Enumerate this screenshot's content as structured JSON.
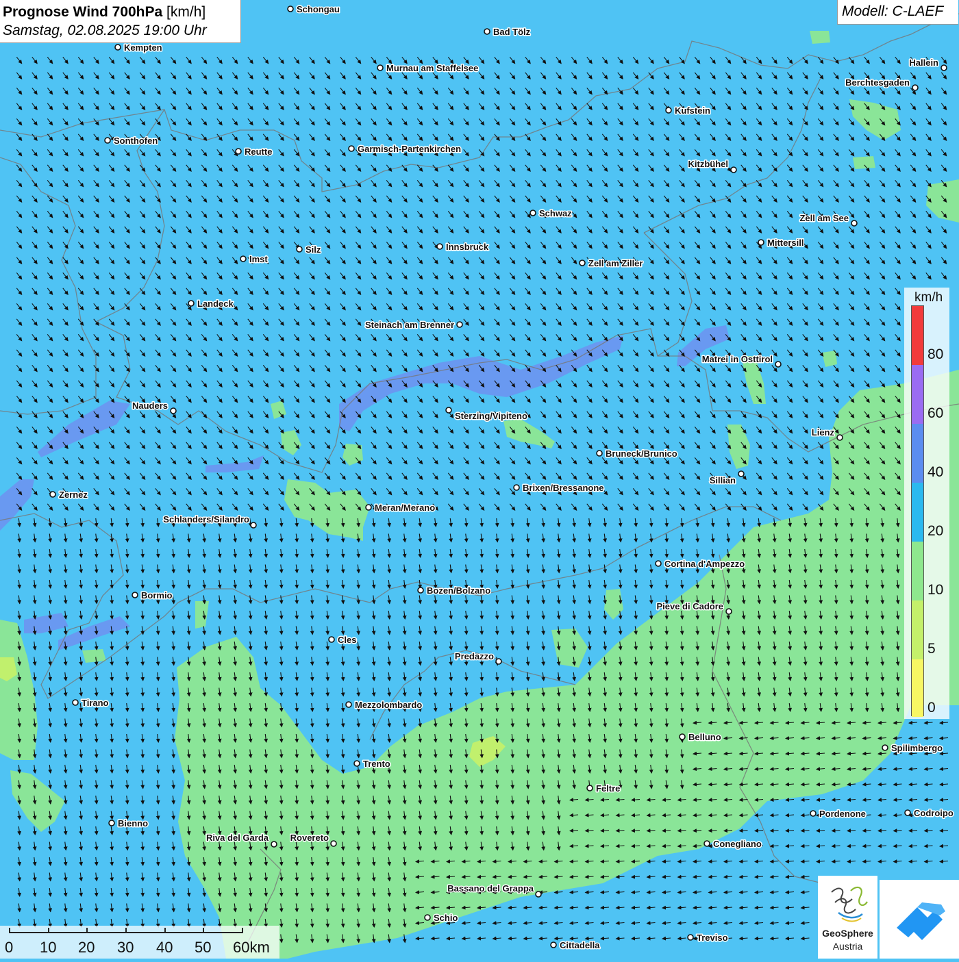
{
  "title": {
    "main_bold": "Prognose Wind 700hPa",
    "main_unit": "[km/h]",
    "datetime": "Samstag, 02.08.2025 19:00 Uhr"
  },
  "model": "Modell: C-LAEF",
  "legend": {
    "unit": "km/h",
    "ticks": [
      "80",
      "60",
      "40",
      "20",
      "10",
      "5",
      "0"
    ],
    "bins": [
      {
        "from": 0,
        "to": 5,
        "color": "#f7f763"
      },
      {
        "from": 5,
        "to": 10,
        "color": "#c4f06a"
      },
      {
        "from": 10,
        "to": 20,
        "color": "#8ee88e"
      },
      {
        "from": 20,
        "to": 40,
        "color": "#2bb9ef"
      },
      {
        "from": 40,
        "to": 60,
        "color": "#5b8df0"
      },
      {
        "from": 60,
        "to": 80,
        "color": "#9a6cf2"
      },
      {
        "from": 80,
        "to": 100,
        "color": "#f23b3b"
      }
    ]
  },
  "scale": {
    "labels": [
      "0",
      "10",
      "20",
      "30",
      "40",
      "50",
      "60km"
    ]
  },
  "logo": {
    "line1": "GeoSphere",
    "line2": "Austria"
  },
  "wind": {
    "prevailing_direction": "northwest",
    "south_direction": "west"
  },
  "cities": [
    {
      "name": "Schongau"
    },
    {
      "name": "Bad Tölz"
    },
    {
      "name": "Kempten"
    },
    {
      "name": "Murnau am Staffelsee"
    },
    {
      "name": "Hallein"
    },
    {
      "name": "Berchtesgaden"
    },
    {
      "name": "Kufstein"
    },
    {
      "name": "Sonthofen"
    },
    {
      "name": "Reutte"
    },
    {
      "name": "Garmisch-Partenkirchen"
    },
    {
      "name": "Kitzbühel"
    },
    {
      "name": "Schwaz"
    },
    {
      "name": "Zell am See"
    },
    {
      "name": "Mittersill"
    },
    {
      "name": "Innsbruck"
    },
    {
      "name": "Silz"
    },
    {
      "name": "Imst"
    },
    {
      "name": "Zell am Ziller"
    },
    {
      "name": "Landeck"
    },
    {
      "name": "Steinach am Brenner"
    },
    {
      "name": "Matrei in Osttirol"
    },
    {
      "name": "Nauders"
    },
    {
      "name": "Sterzing/Vipiteno"
    },
    {
      "name": "Lienz"
    },
    {
      "name": "Bruneck/Brunico"
    },
    {
      "name": "Sillian"
    },
    {
      "name": "Zernez"
    },
    {
      "name": "Brixen/Bressanone"
    },
    {
      "name": "Meran/Merano"
    },
    {
      "name": "Schlanders/Silandro"
    },
    {
      "name": "Cortina d'Ampezzo"
    },
    {
      "name": "Bozen/Bolzano"
    },
    {
      "name": "Bormio"
    },
    {
      "name": "Pieve di Cadore"
    },
    {
      "name": "Cles"
    },
    {
      "name": "Predazzo"
    },
    {
      "name": "Tirano"
    },
    {
      "name": "Mezzolombardo"
    },
    {
      "name": "Belluno"
    },
    {
      "name": "Spilimbergo"
    },
    {
      "name": "Trento"
    },
    {
      "name": "Feltre"
    },
    {
      "name": "Pordenone"
    },
    {
      "name": "Codroipo"
    },
    {
      "name": "Bienno"
    },
    {
      "name": "Riva del Garda"
    },
    {
      "name": "Rovereto"
    },
    {
      "name": "Conegliano"
    },
    {
      "name": "Bassano del Grappa"
    },
    {
      "name": "Schio"
    },
    {
      "name": "Treviso"
    },
    {
      "name": "Cittadella"
    }
  ]
}
